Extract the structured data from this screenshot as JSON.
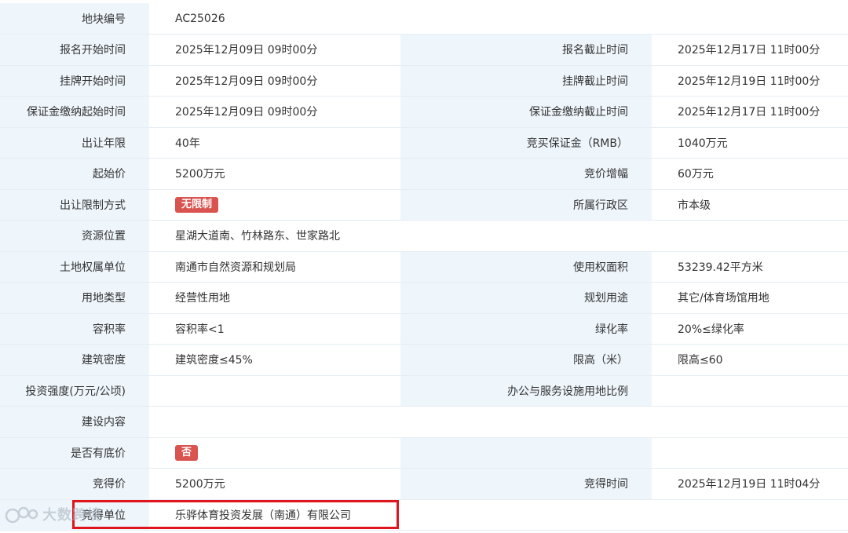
{
  "rows": [
    {
      "l1": "地块编号",
      "v1": "AC25026",
      "l2": "",
      "v2": ""
    },
    {
      "l1": "报名开始时间",
      "v1": "2025年12月09日 09时00分",
      "l2": "报名截止时间",
      "v2": "2025年12月17日 11时00分"
    },
    {
      "l1": "挂牌开始时间",
      "v1": "2025年12月09日 09时00分",
      "l2": "挂牌截止时间",
      "v2": "2025年12月19日 11时00分"
    },
    {
      "l1": "保证金缴纳起始时间",
      "v1": "2025年12月09日 09时00分",
      "l2": "保证金缴纳截止时间",
      "v2": "2025年12月17日 11时00分"
    },
    {
      "l1": "出让年限",
      "v1": "40年",
      "l2": "竞买保证金（RMB）",
      "v2": "1040万元"
    },
    {
      "l1": "起始价",
      "v1": "5200万元",
      "l2": "竞价增幅",
      "v2": "60万元"
    },
    {
      "l1": "出让限制方式",
      "badge1": "无限制",
      "l2": "所属行政区",
      "v2": "市本级"
    },
    {
      "l1": "资源位置",
      "v1": "星湖大道南、竹林路东、世家路北"
    },
    {
      "l1": "土地权属单位",
      "v1": "南通市自然资源和规划局",
      "l2": "使用权面积",
      "v2": "53239.42平方米"
    },
    {
      "l1": "用地类型",
      "v1": "经营性用地",
      "l2": "规划用途",
      "v2": "其它/体育场馆用地"
    },
    {
      "l1": "容积率",
      "v1": "容积率<1",
      "l2": "绿化率",
      "v2": "20%≤绿化率"
    },
    {
      "l1": "建筑密度",
      "v1": "建筑密度≤45%",
      "l2": "限高（米）",
      "v2": "限高≤60"
    },
    {
      "l1": "投资强度(万元/公顷)",
      "v1": "",
      "l2": "办公与服务设施用地比例",
      "v2": ""
    },
    {
      "l1": "建设内容",
      "v1": ""
    },
    {
      "l1": "是否有底价",
      "badge1": "否"
    },
    {
      "l1": "竞得价",
      "v1": "5200万元",
      "l2": "竞得时间",
      "v2": "2025年12月19日 11时04分"
    },
    {
      "l1": "竞得单位",
      "v1": "乐骅体育投资发展（南通）有限公司"
    }
  ],
  "watermark": {
    "text": "大数跨境",
    "logo_icon": "cloud-logo-icon"
  },
  "colors": {
    "label_bg": "#eef6fc",
    "badge_red": "#d9534f",
    "highlight_red": "#e0141c"
  }
}
